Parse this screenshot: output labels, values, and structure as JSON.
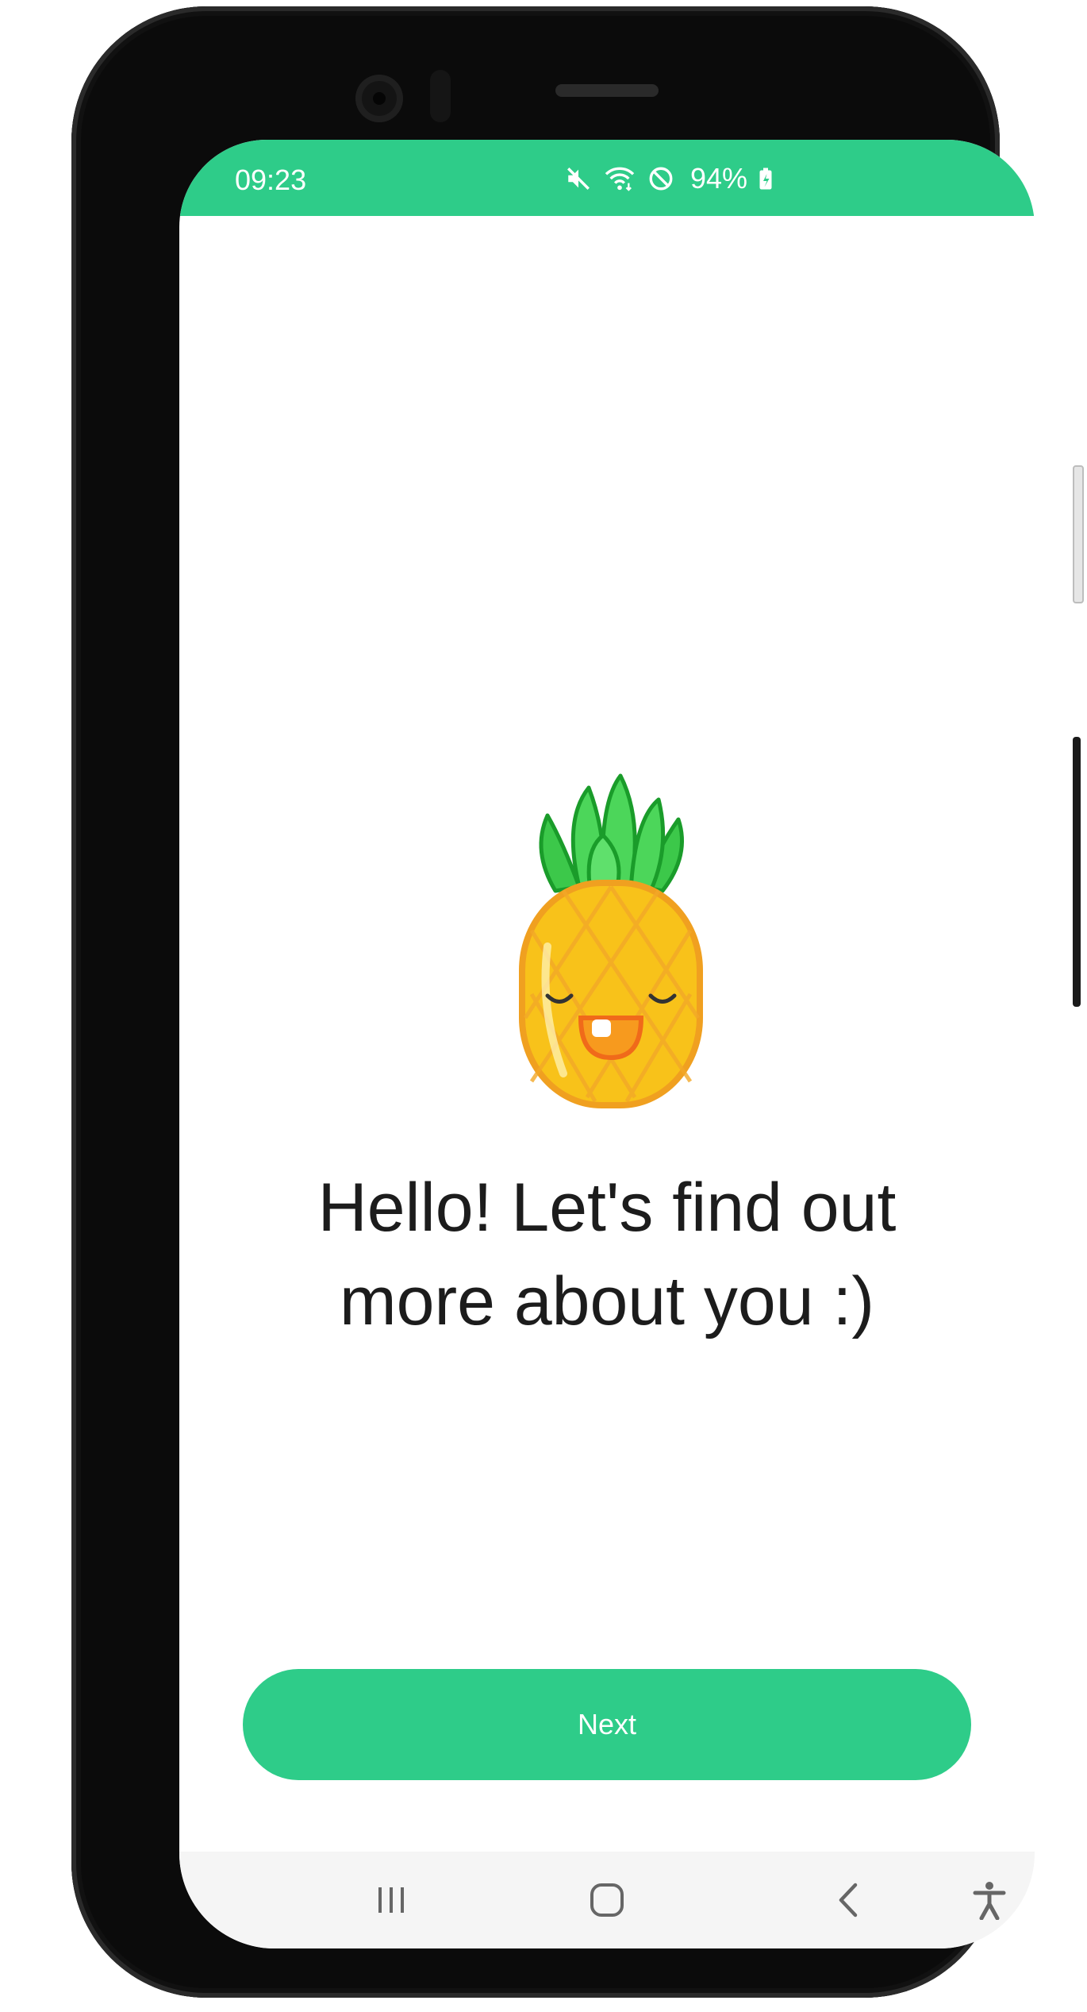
{
  "status_bar": {
    "time": "09:23",
    "battery": "94%",
    "icons": [
      "mute-icon",
      "wifi-icon",
      "do-not-disturb-icon",
      "battery-charging-icon"
    ],
    "color": "#2ecc89"
  },
  "main": {
    "mascot_icon": "pineapple-icon",
    "headline_line1": "Hello! Let's find out",
    "headline_line2": "more about you :)"
  },
  "next_button": {
    "label": "Next",
    "color": "#2ecc89"
  },
  "nav_bar": {
    "buttons": [
      "recents-icon",
      "home-icon",
      "back-icon",
      "accessibility-icon"
    ]
  }
}
